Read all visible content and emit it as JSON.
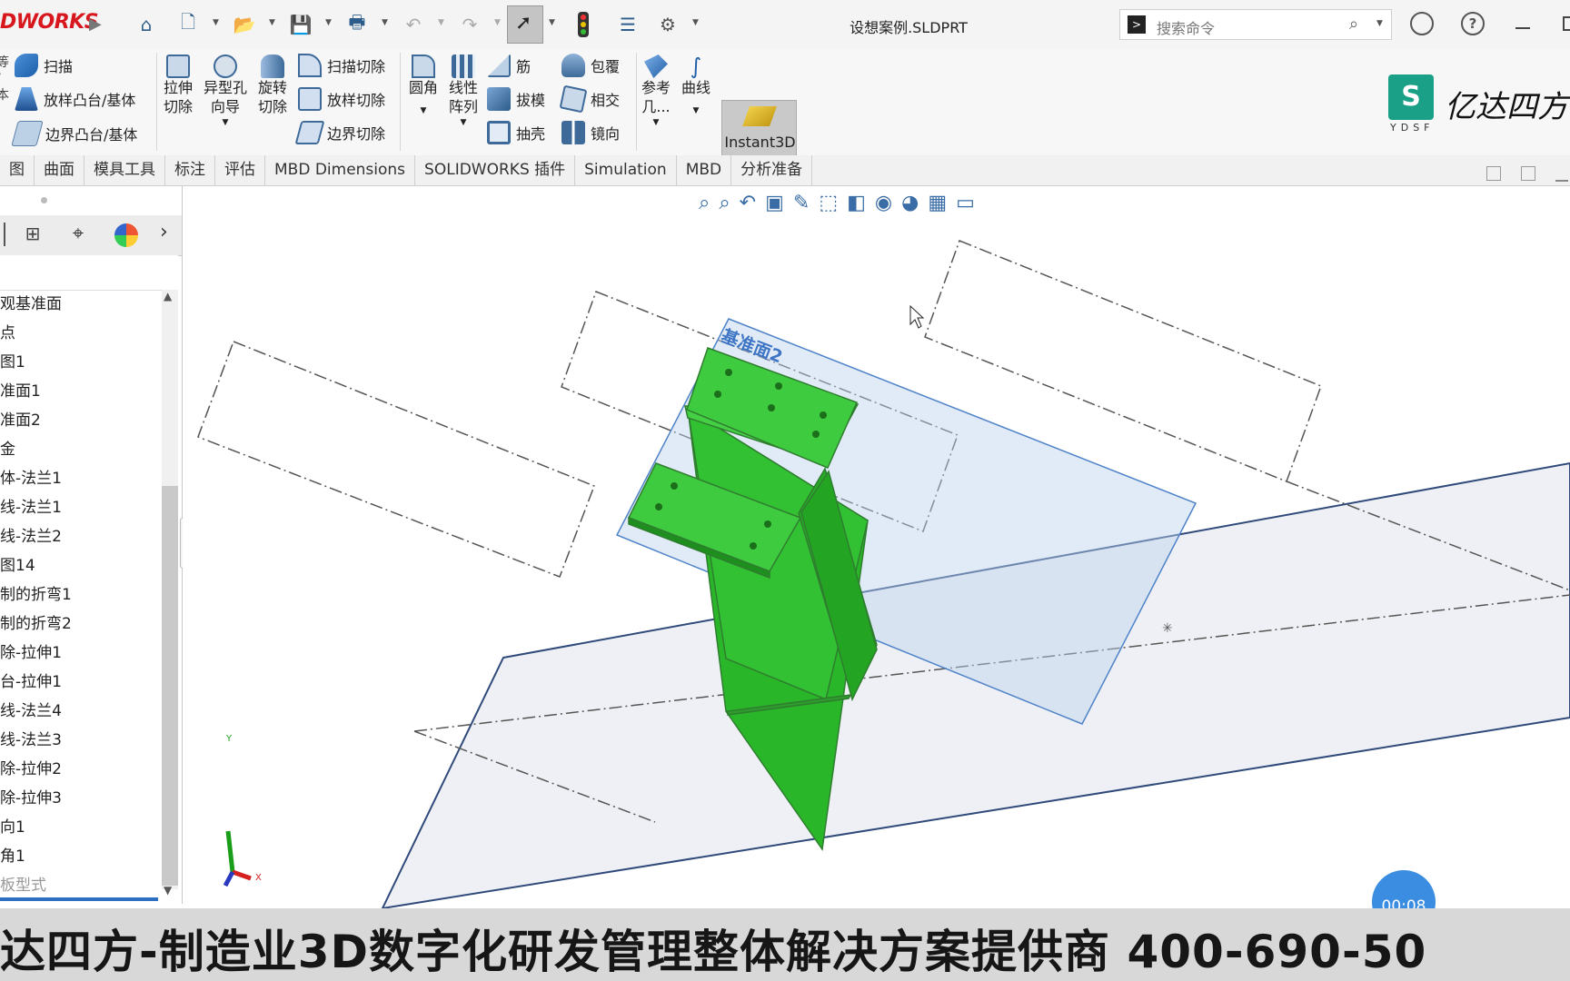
{
  "app": {
    "logo_text": "DWORKS",
    "document_title": "设想案例.SLDPRT"
  },
  "search": {
    "placeholder": "搜索命令"
  },
  "ribbon": {
    "sweep": "扫描",
    "loft_boss": "放样凸台/基体",
    "boundary_boss": "边界凸台/基体",
    "extrude_cut": [
      "拉伸",
      "切除"
    ],
    "hole_wizard": [
      "异型孔",
      "向导"
    ],
    "revolve_cut": [
      "旋转",
      "切除"
    ],
    "sweep_cut": "扫描切除",
    "loft_cut": "放样切除",
    "boundary_cut": "边界切除",
    "fillet": "圆角",
    "linear_pattern": [
      "线性",
      "阵列"
    ],
    "rib": "筋",
    "draft": "拔模",
    "shell": "抽壳",
    "wrap": "包覆",
    "intersect": "相交",
    "mirror": "镜向",
    "reference_geometry": [
      "参考",
      "几..."
    ],
    "curves": "曲线",
    "instant3d": "Instant3D"
  },
  "tabs": [
    "图",
    "曲面",
    "模具工具",
    "标注",
    "评估",
    "MBD Dimensions",
    "SOLIDWORKS 插件",
    "Simulation",
    "MBD",
    "分析准备"
  ],
  "feature_tree": [
    "观基准面",
    "点",
    "图1",
    "准面1",
    "准面2",
    "金",
    "体-法兰1",
    "线-法兰1",
    "线-法兰2",
    "图14",
    "制的折弯1",
    "制的折弯2",
    "除-拉伸1",
    "台-拉伸1",
    "线-法兰4",
    "线-法兰3",
    "除-拉伸2",
    "除-拉伸3",
    "向1",
    "角1",
    "板型式"
  ],
  "viewport": {
    "plane_label": "基准面2",
    "triad_x": "X",
    "triad_y": "Y",
    "model_color": "#2ec52e"
  },
  "brand": {
    "mark": "YDSF",
    "name": "亿达四方"
  },
  "banner": {
    "text": "达四方-制造业3D数字化研发管理整体解决方案提供商  400-690-50"
  },
  "timer": {
    "time": "00:08"
  }
}
